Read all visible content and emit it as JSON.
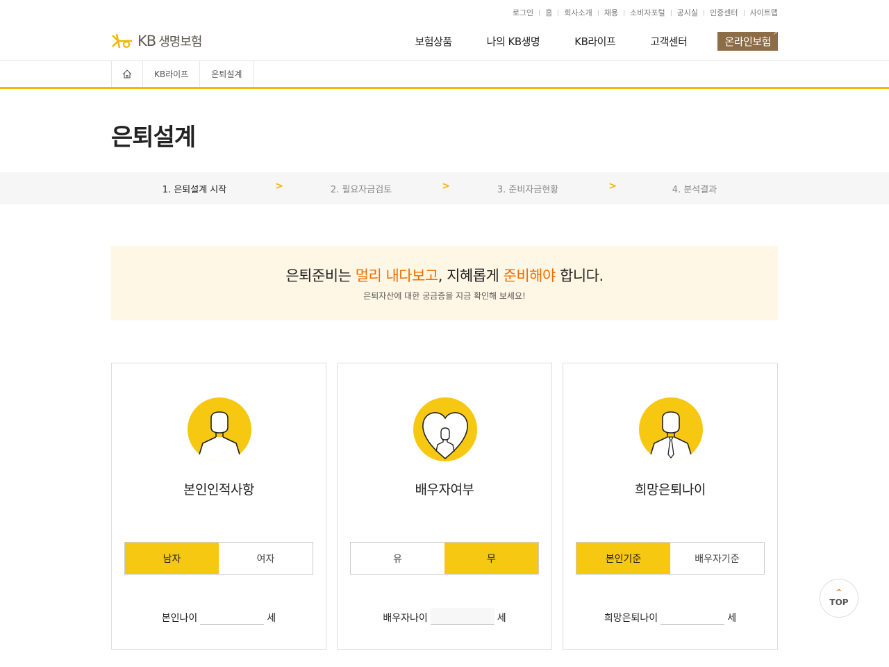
{
  "util_links": [
    "로그인",
    "홈",
    "회사소개",
    "채용",
    "소비자포털",
    "공시실",
    "인증센터",
    "사이트맵"
  ],
  "logo": {
    "kb": "KB",
    "name": "생명보험",
    "icon": "kb-star-logo"
  },
  "gnb": {
    "items": [
      "보험상품",
      "나의 KB생명",
      "KB라이프",
      "고객센터"
    ],
    "online": "온라인보험"
  },
  "breadcrumb": {
    "home_icon": "home-icon",
    "items": [
      "KB라이프",
      "은퇴설계"
    ]
  },
  "page_title": "은퇴설계",
  "steps": [
    {
      "label": "1. 은퇴설계 시작",
      "active": true
    },
    {
      "label": "2. 필요자금검토",
      "active": false
    },
    {
      "label": "3. 준비자금현황",
      "active": false
    },
    {
      "label": "4. 분석결과",
      "active": false
    }
  ],
  "banner": {
    "part1": "은퇴준비는 ",
    "hl1": "멀리 내다보고",
    "part2": ", 지혜롭게 ",
    "hl2": "준비해야",
    "part3": " 합니다.",
    "sub": "은퇴자산에 대한 궁금증을 지금 확인해 보세요!"
  },
  "cards": [
    {
      "title": "본인인적사항",
      "icon": "person-icon",
      "options": [
        "남자",
        "여자"
      ],
      "selected": 0,
      "age_label": "본인나이",
      "unit": "세",
      "value": ""
    },
    {
      "title": "배우자여부",
      "icon": "spouse-heart-icon",
      "options": [
        "유",
        "무"
      ],
      "selected": 1,
      "age_label": "배우자나이",
      "unit": "세",
      "value": ""
    },
    {
      "title": "희망은퇴나이",
      "icon": "person-tie-icon",
      "options": [
        "본인기준",
        "배우자기준"
      ],
      "selected": 0,
      "age_label": "희망은퇴나이",
      "unit": "세",
      "value": ""
    }
  ],
  "top_button": "TOP",
  "colors": {
    "accent": "#f7c812",
    "highlight": "#ee6d00",
    "online_bg": "#8c6d46",
    "banner_bg": "#fff7e5"
  }
}
